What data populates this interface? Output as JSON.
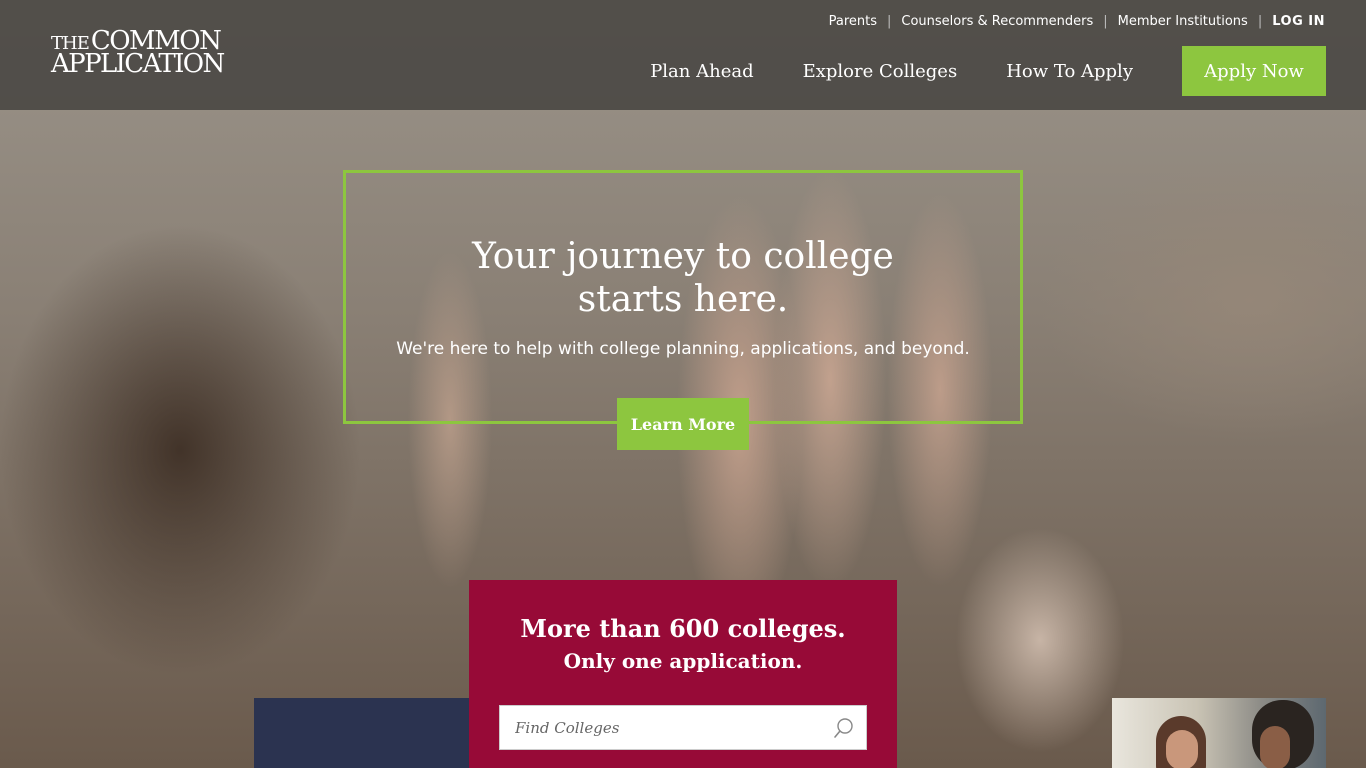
{
  "logo": {
    "line1_small": "THE",
    "line1_large": "COMMON",
    "line2": "APPLICATION"
  },
  "util_nav": {
    "parents": "Parents",
    "counselors": "Counselors & Recommenders",
    "members": "Member Institutions",
    "login": "LOG IN",
    "separator": "|"
  },
  "main_nav": {
    "plan": "Plan Ahead",
    "explore": "Explore Colleges",
    "how": "How To Apply",
    "apply": "Apply Now"
  },
  "hero": {
    "title_line1": "Your journey to college",
    "title_line2": "starts here.",
    "subtitle": "We're here to help with college planning, applications, and beyond.",
    "cta": "Learn More"
  },
  "search_panel": {
    "title": "More than 600 colleges.",
    "subtitle": "Only one application.",
    "placeholder": "Find Colleges",
    "icon": "search-icon"
  },
  "colors": {
    "accent_green": "#8dc63f",
    "maroon": "#970a37",
    "navy": "#2b3350"
  }
}
